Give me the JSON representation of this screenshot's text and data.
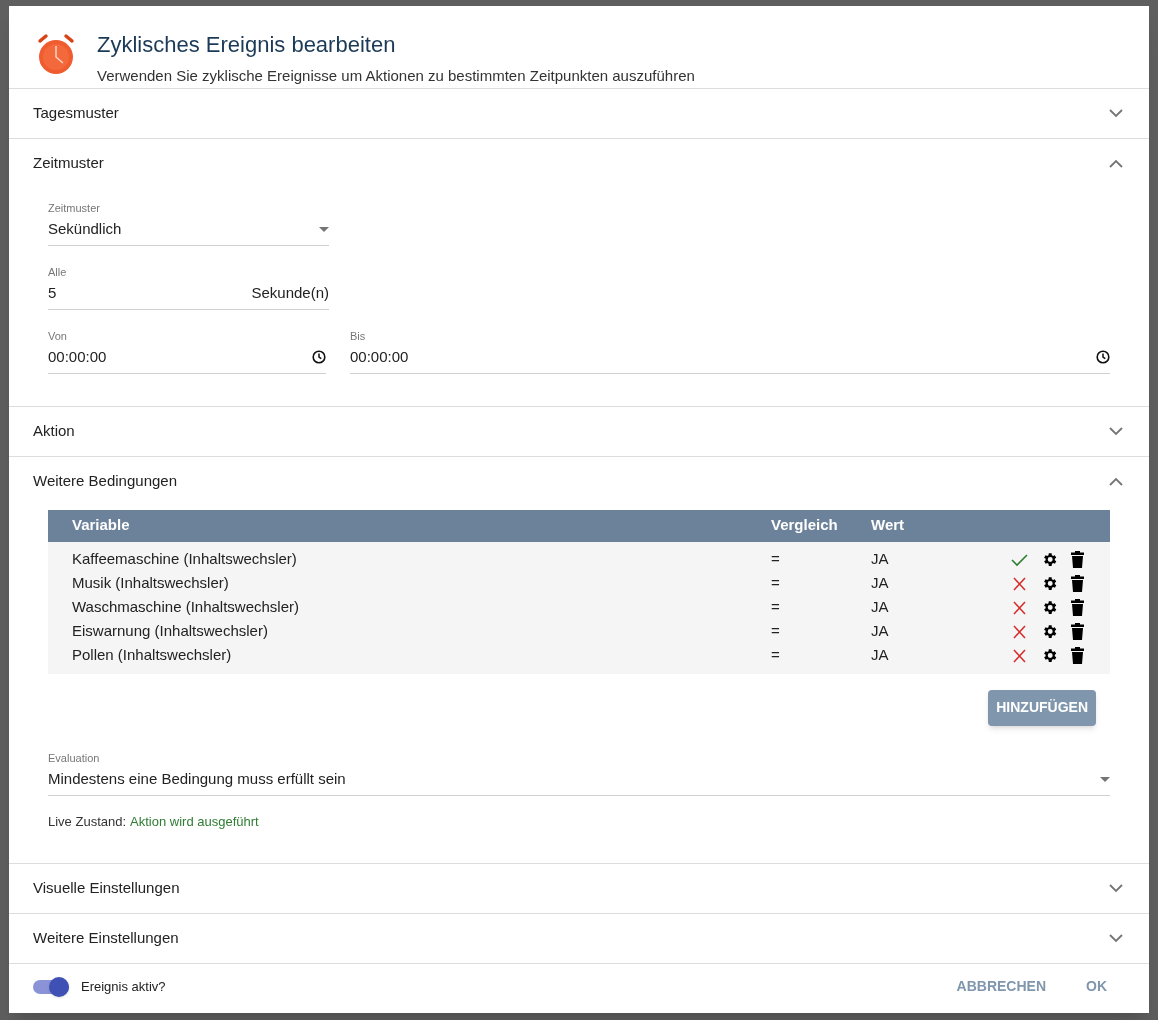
{
  "dialog": {
    "title": "Zyklisches Ereignis bearbeiten",
    "subtitle": "Verwenden Sie zyklische Ereignisse um Aktionen zu bestimmten Zeitpunkten auszuführen"
  },
  "sections": [
    {
      "title": "Tagesmuster",
      "expanded": false
    },
    {
      "title": "Zeitmuster",
      "expanded": true,
      "kind": "time",
      "pattern": {
        "label": "Zeitmuster",
        "value": "Sekündlich"
      },
      "every": {
        "label": "Alle",
        "value": "5",
        "unit": "Sekunde(n)"
      },
      "from": {
        "label": "Von",
        "value": "00:00:00"
      },
      "to": {
        "label": "Bis",
        "value": "00:00:00"
      }
    },
    {
      "title": "Aktion",
      "expanded": false
    },
    {
      "title": "Weitere Bedingungen",
      "expanded": true,
      "kind": "conditions",
      "columns": [
        "Variable",
        "Vergleich",
        "Wert"
      ],
      "rows": [
        {
          "variable": "Kaffeemaschine (Inhaltswechsler)",
          "compare": "=",
          "value": "JA",
          "fulfilled": true
        },
        {
          "variable": "Musik (Inhaltswechsler)",
          "compare": "=",
          "value": "JA",
          "fulfilled": false
        },
        {
          "variable": "Waschmaschine (Inhaltswechsler)",
          "compare": "=",
          "value": "JA",
          "fulfilled": false
        },
        {
          "variable": "Eiswarnung (Inhaltswechsler)",
          "compare": "=",
          "value": "JA",
          "fulfilled": false
        },
        {
          "variable": "Pollen (Inhaltswechsler)",
          "compare": "=",
          "value": "JA",
          "fulfilled": false
        }
      ],
      "add_button": "HINZUFÜGEN",
      "evaluation": {
        "label": "Evaluation",
        "value": "Mindestens eine Bedingung muss erfüllt sein"
      },
      "live": {
        "label": "Live Zustand:",
        "value": "Aktion wird ausgeführt"
      }
    },
    {
      "title": "Visuelle Einstellungen",
      "expanded": false
    },
    {
      "title": "Weitere Einstellungen",
      "expanded": false
    }
  ],
  "footer": {
    "toggle": {
      "label": "Ereignis aktiv?",
      "on": true
    },
    "buttons": [
      "ABBRECHEN",
      "OK"
    ]
  }
}
